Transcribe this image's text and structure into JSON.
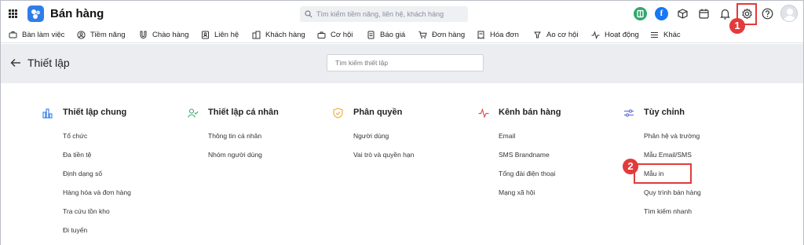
{
  "app": {
    "title": "Bán hàng"
  },
  "search": {
    "placeholder": "Tìm kiếm tiềm năng, liên hệ, khách hàng"
  },
  "topbar_icons": [
    "apps-grid-icon",
    "green-app-icon",
    "facebook-icon",
    "box-icon",
    "calendar-icon",
    "bell-icon",
    "gear-icon",
    "help-icon",
    "avatar"
  ],
  "nav": {
    "items": [
      {
        "label": "Bàn làm việc",
        "icon": "desk-icon"
      },
      {
        "label": "Tiềm năng",
        "icon": "person-icon"
      },
      {
        "label": "Chào hàng",
        "icon": "magnet-icon"
      },
      {
        "label": "Liên hệ",
        "icon": "contact-icon"
      },
      {
        "label": "Khách hàng",
        "icon": "building-icon"
      },
      {
        "label": "Cơ hội",
        "icon": "briefcase-icon"
      },
      {
        "label": "Báo giá",
        "icon": "quote-icon"
      },
      {
        "label": "Đơn hàng",
        "icon": "cart-icon"
      },
      {
        "label": "Hóa đơn",
        "icon": "invoice-icon"
      },
      {
        "label": "Ao cơ hội",
        "icon": "pool-icon"
      },
      {
        "label": "Hoạt động",
        "icon": "activity-icon"
      },
      {
        "label": "Khác",
        "icon": "menu-icon"
      }
    ]
  },
  "settings": {
    "title": "Thiết lập",
    "search_placeholder": "Tìm kiếm thiết lập"
  },
  "columns": [
    {
      "title": "Thiết lập chung",
      "icon": "chart-icon",
      "items": [
        "Tổ chức",
        "Đa tiền tệ",
        "Định dạng số",
        "Hàng hóa và đơn hàng",
        "Tra cứu tồn kho",
        "Đi tuyến"
      ]
    },
    {
      "title": "Thiết lập cá nhân",
      "icon": "user-check-icon",
      "items": [
        "Thông tin cá nhân",
        "Nhóm người dùng"
      ]
    },
    {
      "title": "Phân quyền",
      "icon": "shield-icon",
      "items": [
        "Người dùng",
        "Vai trò và quyền hạn"
      ]
    },
    {
      "title": "Kênh bán hàng",
      "icon": "pulse-icon",
      "items": [
        "Email",
        "SMS Brandname",
        "Tổng đài điện thoại",
        "Mạng xã hội"
      ]
    },
    {
      "title": "Tùy chỉnh",
      "icon": "sliders-icon",
      "items": [
        "Phân hệ và trường",
        "Mẫu Email/SMS",
        "Mẫu in",
        "Quy trình bán hàng",
        "Tìm kiếm nhanh"
      ]
    }
  ],
  "annotations": {
    "step1": "1",
    "step2": "2"
  },
  "colors": {
    "accent": "#2f7ee8",
    "highlight": "#e23b3b",
    "subheader_bg": "#ebedf0"
  }
}
